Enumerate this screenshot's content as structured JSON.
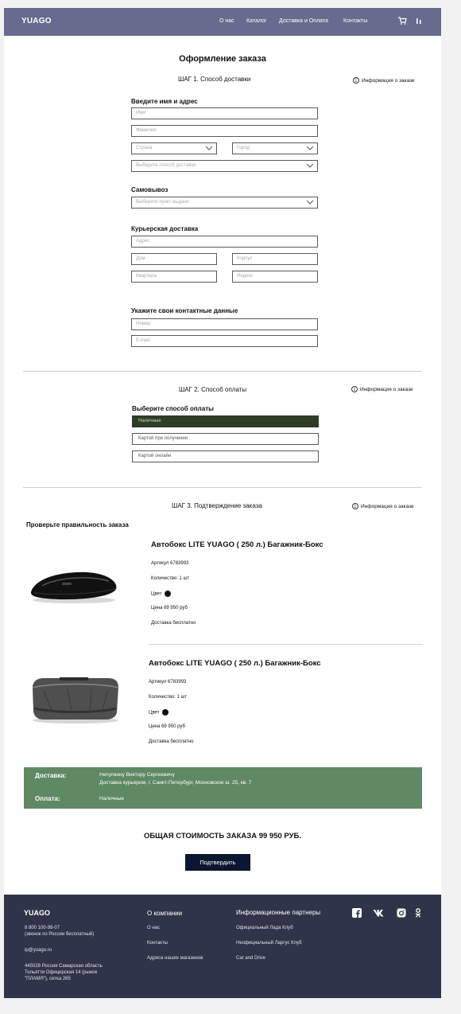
{
  "header": {
    "logo": "YUAGO",
    "nav": [
      "О нас",
      "Каталог",
      "Доставка и Оплата",
      "Контакты"
    ]
  },
  "page_title": "Оформление заказа",
  "info_label": "Информация о заказе",
  "step1": {
    "title": "ШАГ 1.  Способ доставки",
    "name_section": "Введите имя и адрес",
    "name_ph": "Имя",
    "surname_ph": "Фамилия",
    "country_ph": "Страна",
    "city_ph": "Город",
    "delivery_method_ph": "Выберите способ доставки",
    "pickup_section": "Самовывоз",
    "pickup_ph": "Выберите пункт выдачи",
    "courier_section": "Курьерская доставка",
    "address_ph": "Адрес",
    "house_ph": "Дом",
    "building_ph": "Корпус",
    "apartment_ph": "Квартира",
    "index_ph": "Индекс",
    "contacts_section": "Укажите свои контактные данные",
    "phone_ph": "Номер",
    "email_ph": "E-mail"
  },
  "step2": {
    "title": "ШАГ 2.  Способ оплаты",
    "section": "Выберите способ оплаты",
    "options": [
      "Наличные",
      "Картой при получении",
      "Картой онлайн"
    ],
    "selected": "Наличные"
  },
  "step3": {
    "title": "ШАГ 3.  Подтверждение заказа",
    "check": "Проверьте правильность заказа"
  },
  "products": [
    {
      "title": "Автобокс LITE YUAGO ( 250 л.) Багажник-Бокс",
      "article": "Артикул 6783993",
      "quantity": "Количество: 1 шт",
      "color_label": "Цвет",
      "price": "Цена 69 950 руб",
      "delivery": "Доставка бесплатно"
    },
    {
      "title": "Автобокс LITE YUAGO ( 250 л.) Багажник-Бокс",
      "article": "Артикул 6783993",
      "quantity": "Количество: 1 шт",
      "color_label": "Цвет",
      "price": "Цена 69 950 руб",
      "delivery": "Доставка бесплатно"
    }
  ],
  "summary": {
    "delivery_label": "Доставка:",
    "delivery_name": "Непупкину Виктору Сергеевичу",
    "delivery_address": "Доставка курьером, г. Санкт-Петербург, Московское ш. 25, кв. 7",
    "payment_label": "Оплата:",
    "payment_value": "Наличные"
  },
  "total": "ОБЩАЯ СТОИМОСТЬ ЗАКАЗА 99 950 РУБ.",
  "confirm_label": "Подтвердить",
  "footer": {
    "logo": "YUAGO",
    "phone": "8 800 100-99-07",
    "phone_note": "(звонок по России бесплатный)",
    "email": "ip@yuago.ru",
    "address1": "445028 Россия Самарская область",
    "address2": "Тольятти Офицерская 14 (рынок",
    "address3": "\"ПЛАМЯ\"), сетка 265",
    "company_head": "О компании",
    "company_links": [
      "О нас",
      "Контакты",
      "Адреса наших магазинов"
    ],
    "partners_head": "Информационные партнеры",
    "partners_links": [
      "Официальный Лада Клуб",
      "Неофициальный Ларгус Клуб",
      "Car and Drive"
    ]
  },
  "colors": {
    "header_bg": "#686b8e",
    "summary_bg": "#5f8962",
    "selected_payment_bg": "#2e3d24",
    "confirm_bg": "#0b1731",
    "footer_bg": "#30344a"
  }
}
